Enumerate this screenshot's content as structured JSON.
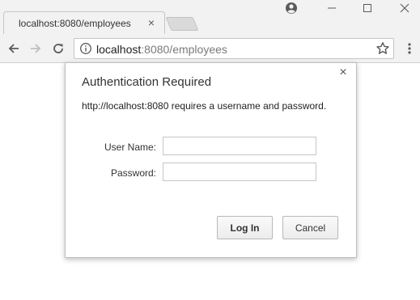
{
  "browser": {
    "tab": {
      "title": "localhost:8080/employees",
      "close_glyph": "×"
    },
    "address_bar": {
      "host": "localhost",
      "path": ":8080/employees"
    },
    "window_controls": {
      "minimize": "—",
      "maximize": "☐",
      "close": "✕"
    }
  },
  "dialog": {
    "title": "Authentication Required",
    "message": "http://localhost:8080 requires a username and password.",
    "close_glyph": "×",
    "fields": {
      "username_label": "User Name:",
      "username_value": "",
      "password_label": "Password:",
      "password_value": ""
    },
    "buttons": {
      "login": "Log In",
      "cancel": "Cancel"
    }
  },
  "colors": {
    "chrome_bg": "#f2f2f2",
    "icon": "#5a5a5a",
    "icon_disabled": "#bdbdbd",
    "url_path": "#7a7a7a"
  },
  "icons": [
    "profile-icon",
    "minimize-icon",
    "maximize-icon",
    "window-close-icon",
    "back-arrow-icon",
    "forward-arrow-icon",
    "reload-icon",
    "info-icon",
    "star-icon",
    "menu-dots-icon",
    "close-icon"
  ]
}
